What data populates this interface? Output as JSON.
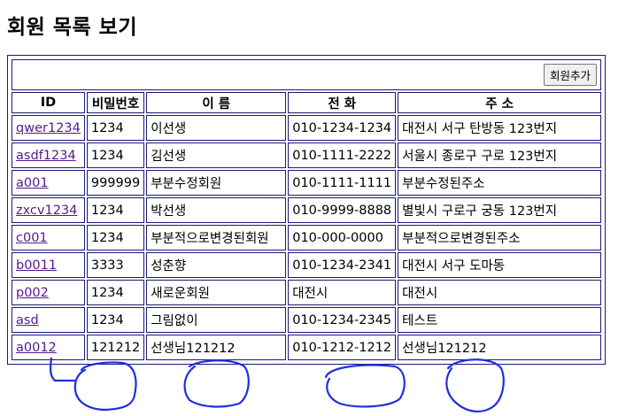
{
  "page": {
    "title": "회원 목록 보기"
  },
  "toolbar": {
    "add_label": "회원추가"
  },
  "table": {
    "headers": [
      "ID",
      "비밀번호",
      "이 름",
      "전 화",
      "주 소"
    ],
    "rows": [
      {
        "id": "qwer1234",
        "pw": "1234",
        "name": "이선생",
        "phone": "010-1234-1234",
        "addr": "대전시 서구 탄방동 123번지"
      },
      {
        "id": "asdf1234",
        "pw": "1234",
        "name": "김선생",
        "phone": "010-1111-2222",
        "addr": "서울시 종로구 구로 123번지"
      },
      {
        "id": "a001",
        "pw": "999999",
        "name": "부분수정회원",
        "phone": "010-1111-1111",
        "addr": "부분수정된주소"
      },
      {
        "id": "zxcv1234",
        "pw": "1234",
        "name": "박선생",
        "phone": "010-9999-8888",
        "addr": "별빛시 구로구 궁동 123번지"
      },
      {
        "id": "c001",
        "pw": "1234",
        "name": "부분적으로변경된회원",
        "phone": "010-000-0000",
        "addr": "부분적으로변경된주소"
      },
      {
        "id": "b0011",
        "pw": "3333",
        "name": "성춘향",
        "phone": "010-1234-2341",
        "addr": "대전시 서구 도마동"
      },
      {
        "id": "p002",
        "pw": "1234",
        "name": "새로운회원",
        "phone": "대전시",
        "addr": "대전시"
      },
      {
        "id": "asd",
        "pw": "1234",
        "name": "그림없이",
        "phone": "010-1234-2345",
        "addr": "테스트"
      },
      {
        "id": "a0012",
        "pw": "121212",
        "name": "선생님121212",
        "phone": "010-1212-1212",
        "addr": "선생님121212"
      }
    ]
  },
  "colors": {
    "border": "#1a1a7a",
    "link": "#551a8b",
    "annotation": "#1e2ee0"
  }
}
